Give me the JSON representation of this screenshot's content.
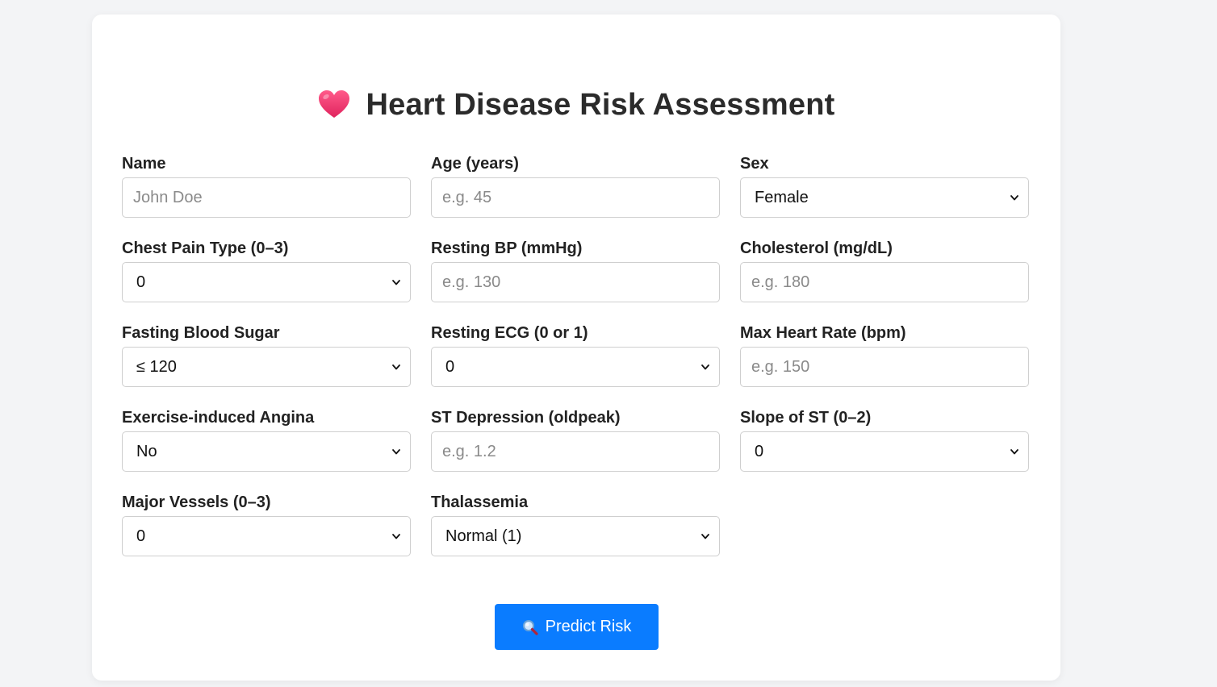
{
  "app": {
    "title": "Heart Disease Risk Assessment",
    "title_icon": "heart-icon",
    "accent_color": "#0a7cff",
    "heart_color": "#f0386b"
  },
  "form": {
    "name": {
      "label": "Name",
      "placeholder": "John Doe"
    },
    "age": {
      "label": "Age (years)",
      "placeholder": "e.g. 45"
    },
    "sex": {
      "label": "Sex",
      "value": "Female"
    },
    "chest_pain": {
      "label": "Chest Pain Type (0–3)",
      "value": "0"
    },
    "resting_bp": {
      "label": "Resting BP (mmHg)",
      "placeholder": "e.g. 130"
    },
    "cholesterol": {
      "label": "Cholesterol (mg/dL)",
      "placeholder": "e.g. 180"
    },
    "fasting_sugar": {
      "label": "Fasting Blood Sugar",
      "value": "≤ 120"
    },
    "resting_ecg": {
      "label": "Resting ECG (0 or 1)",
      "value": "0"
    },
    "max_hr": {
      "label": "Max Heart Rate (bpm)",
      "placeholder": "e.g. 150"
    },
    "angina": {
      "label": "Exercise-induced Angina",
      "value": "No"
    },
    "oldpeak": {
      "label": "ST Depression (oldpeak)",
      "placeholder": "e.g. 1.2"
    },
    "slope": {
      "label": "Slope of ST (0–2)",
      "value": "0"
    },
    "vessels": {
      "label": "Major Vessels (0–3)",
      "value": "0"
    },
    "thal": {
      "label": "Thalassemia",
      "value": "Normal (1)"
    }
  },
  "actions": {
    "predict_label": "Predict Risk",
    "predict_icon": "magnifier-icon"
  }
}
